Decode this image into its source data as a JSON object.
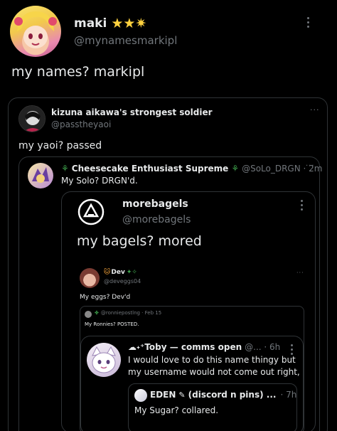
{
  "post": {
    "display_name": "maki",
    "stars": "★★",
    "sparkle_star": "✷",
    "handle": "@mynamesmarkipl",
    "text": "my names? markipl",
    "more": "⋮"
  },
  "quote1": {
    "display_name": "kizuna aikawa's strongest soldier",
    "handle": "@passtheyaoi",
    "text": "my yaoi? passed",
    "more": "···"
  },
  "quote2": {
    "display_name": "Cheesecake Enthusiast Supreme",
    "handle_time": "@SoLo_DRGN · 2m",
    "text": "My Solo? DRGN'd.",
    "more": "···"
  },
  "quote3": {
    "display_name": "morebagels",
    "handle": "@morebagels",
    "text": "my bagels? mored",
    "more": "⋮"
  },
  "quote4": {
    "display_name": "Dev",
    "handle": "@deveggs04",
    "text": "My eggs? Dev'd",
    "more": "···"
  },
  "quote5": {
    "display_name": "✤",
    "handle_time": "@ronniepostlng · Feb 15",
    "text": "My Ronnies? POSTED."
  },
  "quote6": {
    "display_name": "☁˖⁺Toby — comms open",
    "handle_time": "@... · 6h",
    "text_line1": "I would love to do this name thingy but",
    "text_line2": "my username would not come out right,",
    "more": "⋮"
  },
  "quote7": {
    "display_name": "EDEN",
    "name_suffix": "(discord n pins) ...",
    "time": "· 7h",
    "text": "My Sugar? collared."
  },
  "colors": {
    "background": "#000000",
    "text": "#e7e9ea",
    "secondary": "#71767b",
    "border": "#2f3336",
    "star": "#ffd23f"
  }
}
